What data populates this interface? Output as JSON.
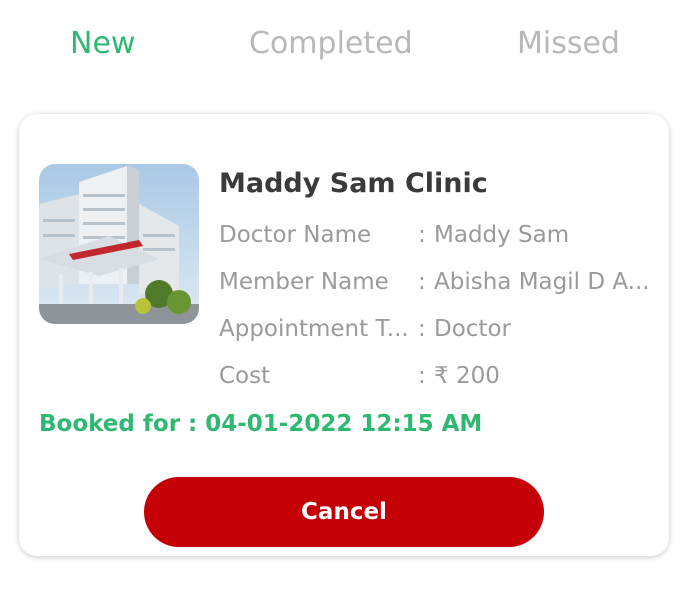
{
  "tabs": [
    {
      "label": "New",
      "active": true
    },
    {
      "label": "Completed",
      "active": false
    },
    {
      "label": "Missed",
      "active": false
    }
  ],
  "appointment": {
    "clinic_name": "Maddy Sam Clinic",
    "image_icon": "hospital-photo",
    "details": [
      {
        "label": "Doctor Name",
        "value": "Maddy Sam"
      },
      {
        "label": "Member Name",
        "value": "Abisha Magil D A..."
      },
      {
        "label": "Appointment T...",
        "value": "Doctor"
      },
      {
        "label": "Cost",
        "value": "₹ 200"
      }
    ],
    "separator": ":",
    "booked_for": "Booked for : 04-01-2022 12:15 AM",
    "cancel_label": "Cancel"
  },
  "colors": {
    "accent": "#2eb872",
    "tab_inactive": "#b8b8b8",
    "danger": "#c40006"
  }
}
